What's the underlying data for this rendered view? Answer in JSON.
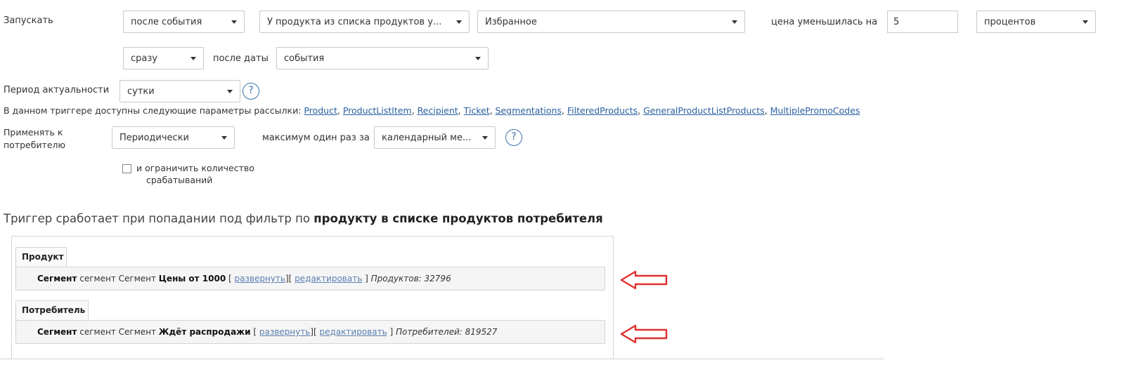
{
  "trigger": {
    "launch_label": "Запускать",
    "event_timing": "после события",
    "product_condition": "У продукта из списка продуктов у...",
    "list_name": "Избранное",
    "price_decrease_label": "цена уменьшилась на",
    "price_decrease_value": "5",
    "unit": "процентов",
    "delay": "сразу",
    "after_date_label": "после даты",
    "date_source": "события"
  },
  "relevance": {
    "label": "Период актуальности",
    "value": "сутки",
    "help": "?"
  },
  "params": {
    "intro": "В данном триггере доступны следующие параметры рассылки:",
    "links": [
      "Product",
      "ProductListItem",
      "Recipient",
      "Ticket",
      "Segmentations",
      "FilteredProducts",
      "GeneralProductListProducts",
      "MultiplePromoCodes"
    ]
  },
  "apply": {
    "label_line1": "Применять к",
    "label_line2": "потребителю",
    "mode": "Периодически",
    "max_once_label": "максимум один раз за",
    "period": "календарный ме...",
    "help": "?",
    "limit_line1": "и ограничить количество",
    "limit_line2": "срабатываний"
  },
  "filter_heading": {
    "prefix": "Триггер сработает при попадании под фильтр по",
    "bold": "продукту в списке продуктов потребителя"
  },
  "product_tab": {
    "title": "Продукт",
    "seg_bold": "Сегмент",
    "seg_text": "сегмент Сегмент",
    "seg_name": "Цены от 1000",
    "open_bracket": "[",
    "expand": "развернуть",
    "mid_bracket": "][",
    "edit": "редактировать",
    "close_bracket": "]",
    "count": "Продуктов: 32796"
  },
  "consumer_tab": {
    "title": "Потребитель",
    "seg_bold": "Сегмент",
    "seg_text": "сегмент Сегмент",
    "seg_name": "Ждёт распродажи",
    "open_bracket": "[",
    "expand": "развернуть",
    "mid_bracket": "][",
    "edit": "редактировать",
    "close_bracket": "]",
    "count": "Потребителей: 819527"
  },
  "annotation_color": "#e03030"
}
